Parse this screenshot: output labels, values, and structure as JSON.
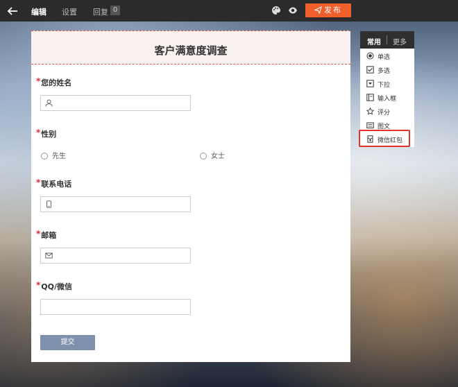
{
  "topbar": {
    "tabs": [
      {
        "label": "编辑"
      },
      {
        "label": "设置"
      },
      {
        "label": "回复"
      }
    ],
    "reply_count": "0",
    "publish_label": "发布",
    "accent_color": "#f05f2a"
  },
  "form": {
    "title": "客户满意度调查",
    "questions": [
      {
        "label": "您的姓名",
        "required": "*",
        "icon": "user-icon"
      },
      {
        "label": "性别",
        "required": "*",
        "options": [
          "先生",
          "女士"
        ]
      },
      {
        "label": "联系电话",
        "required": "*",
        "icon": "phone-icon"
      },
      {
        "label": "邮箱",
        "required": "*",
        "icon": "mail-icon"
      },
      {
        "label": "QQ/微信",
        "required": "*"
      }
    ],
    "submit_label": "提交"
  },
  "palette": {
    "tabs": [
      "常用",
      "更多"
    ],
    "items": [
      {
        "label": "单选",
        "icon": "radio-icon"
      },
      {
        "label": "多选",
        "icon": "checkbox-icon"
      },
      {
        "label": "下拉",
        "icon": "dropdown-icon"
      },
      {
        "label": "输入框",
        "icon": "textbox-icon"
      },
      {
        "label": "评分",
        "icon": "star-icon"
      },
      {
        "label": "图文",
        "icon": "image-text-icon"
      },
      {
        "label": "微信红包",
        "icon": "red-packet-icon"
      }
    ]
  }
}
